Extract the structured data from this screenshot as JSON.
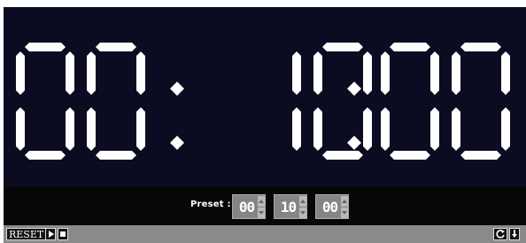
{
  "timer": {
    "display": "00:10:00"
  },
  "preset": {
    "label": "Preset :",
    "hours": "00",
    "minutes": "10",
    "seconds": "00"
  },
  "toolbar": {
    "reset_label": "RESET"
  },
  "icons": {
    "play": "play-icon",
    "stop": "stop-icon",
    "refresh": "refresh-icon",
    "download": "download-icon",
    "spin_up": "chevron-up-icon",
    "spin_down": "chevron-down-icon"
  },
  "colors": {
    "display_bg": "#0b0b22",
    "digit": "#ffffff",
    "preset_bg": "#070707",
    "toolbar_bg": "#8a8a8a"
  }
}
